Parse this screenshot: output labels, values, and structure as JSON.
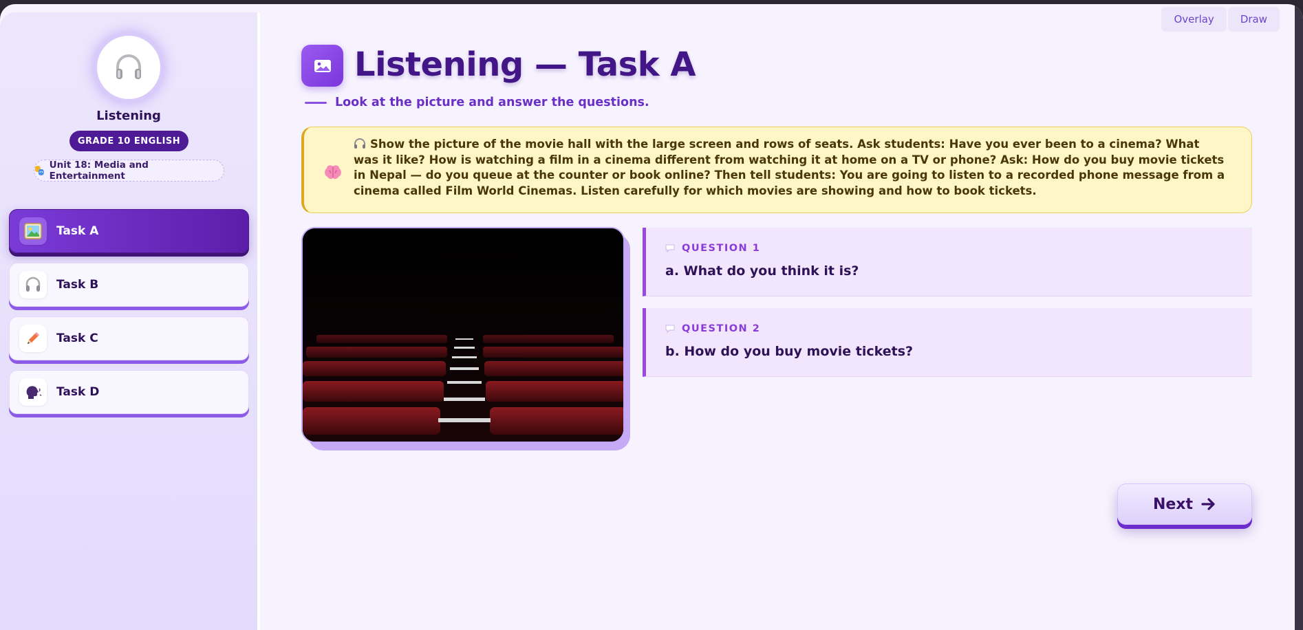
{
  "toolbar": {
    "overlay_label": "Overlay",
    "draw_label": "Draw"
  },
  "sidebar": {
    "title": "Listening",
    "grade_badge": "GRADE 10 ENGLISH",
    "unit": "Unit 18: Media and Entertainment",
    "tasks": [
      {
        "label": "Task A",
        "icon": "picture-icon",
        "active": true
      },
      {
        "label": "Task B",
        "icon": "headphones-icon",
        "active": false
      },
      {
        "label": "Task C",
        "icon": "pencil-icon",
        "active": false
      },
      {
        "label": "Task D",
        "icon": "speaking-head-icon",
        "active": false
      }
    ]
  },
  "main": {
    "title": "Listening — Task A",
    "subtitle": "Look at the picture and answer the questions.",
    "teacher_note": "Show the picture of the movie hall with the large screen and rows of seats. Ask students: Have you ever been to a cinema? What was it like? How is watching a film in a cinema different from watching it at home on a TV or phone? Ask: How do you buy movie tickets in Nepal — do you queue at the counter or book online? Then tell students: You are going to listen to a recorded phone message from a cinema called Film World Cinemas. Listen carefully for which movies are showing and how to book tickets.",
    "questions": [
      {
        "heading": "QUESTION 1",
        "text": "a. What do you think it is?"
      },
      {
        "heading": "QUESTION 2",
        "text": "b. How do you buy movie tickets?"
      }
    ],
    "next_label": "Next"
  },
  "colors": {
    "accent": "#5c1ea9",
    "title": "#421686",
    "note_bg": "#fef6c7",
    "question_bg": "#f2e6fd"
  }
}
